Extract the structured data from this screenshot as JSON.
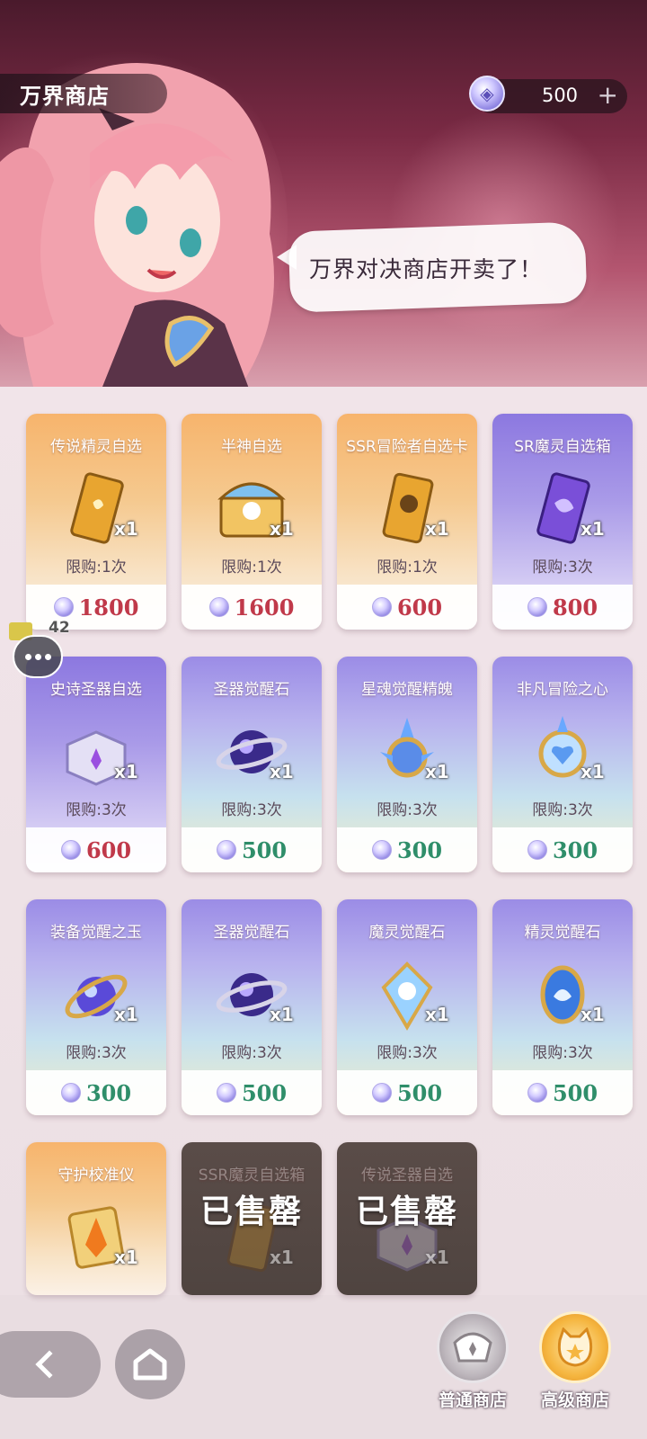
{
  "header": {
    "title": "万界商店",
    "currency_amount": "500",
    "currency_plus": "+",
    "speech": "万界对决商店开卖了！"
  },
  "chat": {
    "unread_count": "42"
  },
  "shop": {
    "items": [
      {
        "name": "传说精灵自选",
        "qty": "x1",
        "limit": "限购:1次",
        "price": "1800",
        "price_color": "red",
        "theme": "gold",
        "icon": "gold-card-icon"
      },
      {
        "name": "半神自选",
        "qty": "x1",
        "limit": "限购:1次",
        "price": "1600",
        "price_color": "red",
        "theme": "gold",
        "icon": "treasure-chest-icon"
      },
      {
        "name": "SSR冒险者自选卡",
        "qty": "x1",
        "limit": "限购:1次",
        "price": "600",
        "price_color": "red",
        "theme": "gold",
        "icon": "hero-card-icon"
      },
      {
        "name": "SR魔灵自选箱",
        "qty": "x1",
        "limit": "限购:3次",
        "price": "800",
        "price_color": "red",
        "theme": "purple",
        "icon": "purple-card-icon"
      },
      {
        "name": "史诗圣器自选",
        "qty": "x1",
        "limit": "限购:3次",
        "price": "600",
        "price_color": "red",
        "theme": "purple",
        "icon": "crystal-box-icon"
      },
      {
        "name": "圣器觉醒石",
        "qty": "x1",
        "limit": "限购:3次",
        "price": "500",
        "price_color": "green",
        "theme": "cyan",
        "icon": "orb-ring-icon"
      },
      {
        "name": "星魂觉醒精魄",
        "qty": "x1",
        "limit": "限购:3次",
        "price": "300",
        "price_color": "green",
        "theme": "cyan",
        "icon": "star-emblem-icon"
      },
      {
        "name": "非凡冒险之心",
        "qty": "x1",
        "limit": "限购:3次",
        "price": "300",
        "price_color": "green",
        "theme": "cyan",
        "icon": "heart-emblem-icon"
      },
      {
        "name": "装备觉醒之玉",
        "qty": "x1",
        "limit": "限购:3次",
        "price": "300",
        "price_color": "green",
        "theme": "cyan",
        "icon": "jade-orb-icon"
      },
      {
        "name": "圣器觉醒石",
        "qty": "x1",
        "limit": "限购:3次",
        "price": "500",
        "price_color": "green",
        "theme": "cyan",
        "icon": "orb-ring-icon"
      },
      {
        "name": "魔灵觉醒石",
        "qty": "x1",
        "limit": "限购:3次",
        "price": "500",
        "price_color": "green",
        "theme": "cyan",
        "icon": "spirit-crest-icon"
      },
      {
        "name": "精灵觉醒石",
        "qty": "x1",
        "limit": "限购:3次",
        "price": "500",
        "price_color": "green",
        "theme": "cyan",
        "icon": "fairy-crest-icon"
      },
      {
        "name": "守护校准仪",
        "qty": "x1",
        "theme": "gold",
        "icon": "guardian-shard-icon"
      },
      {
        "name": "SSR魔灵自选箱",
        "qty": "x1",
        "theme": "sold",
        "soldout": "已售罄",
        "icon": "card-icon"
      },
      {
        "name": "传说圣器自选",
        "qty": "x1",
        "theme": "sold",
        "soldout": "已售罄",
        "icon": "crystal-box-icon"
      }
    ]
  },
  "bottom_nav": {
    "normal_shop": "普通商店",
    "premium_shop": "高级商店"
  },
  "colors": {
    "price_red": "#c0394a",
    "price_green": "#2f8e6a",
    "gold_theme": "#f7b46c",
    "purple_theme": "#8c78e0"
  }
}
